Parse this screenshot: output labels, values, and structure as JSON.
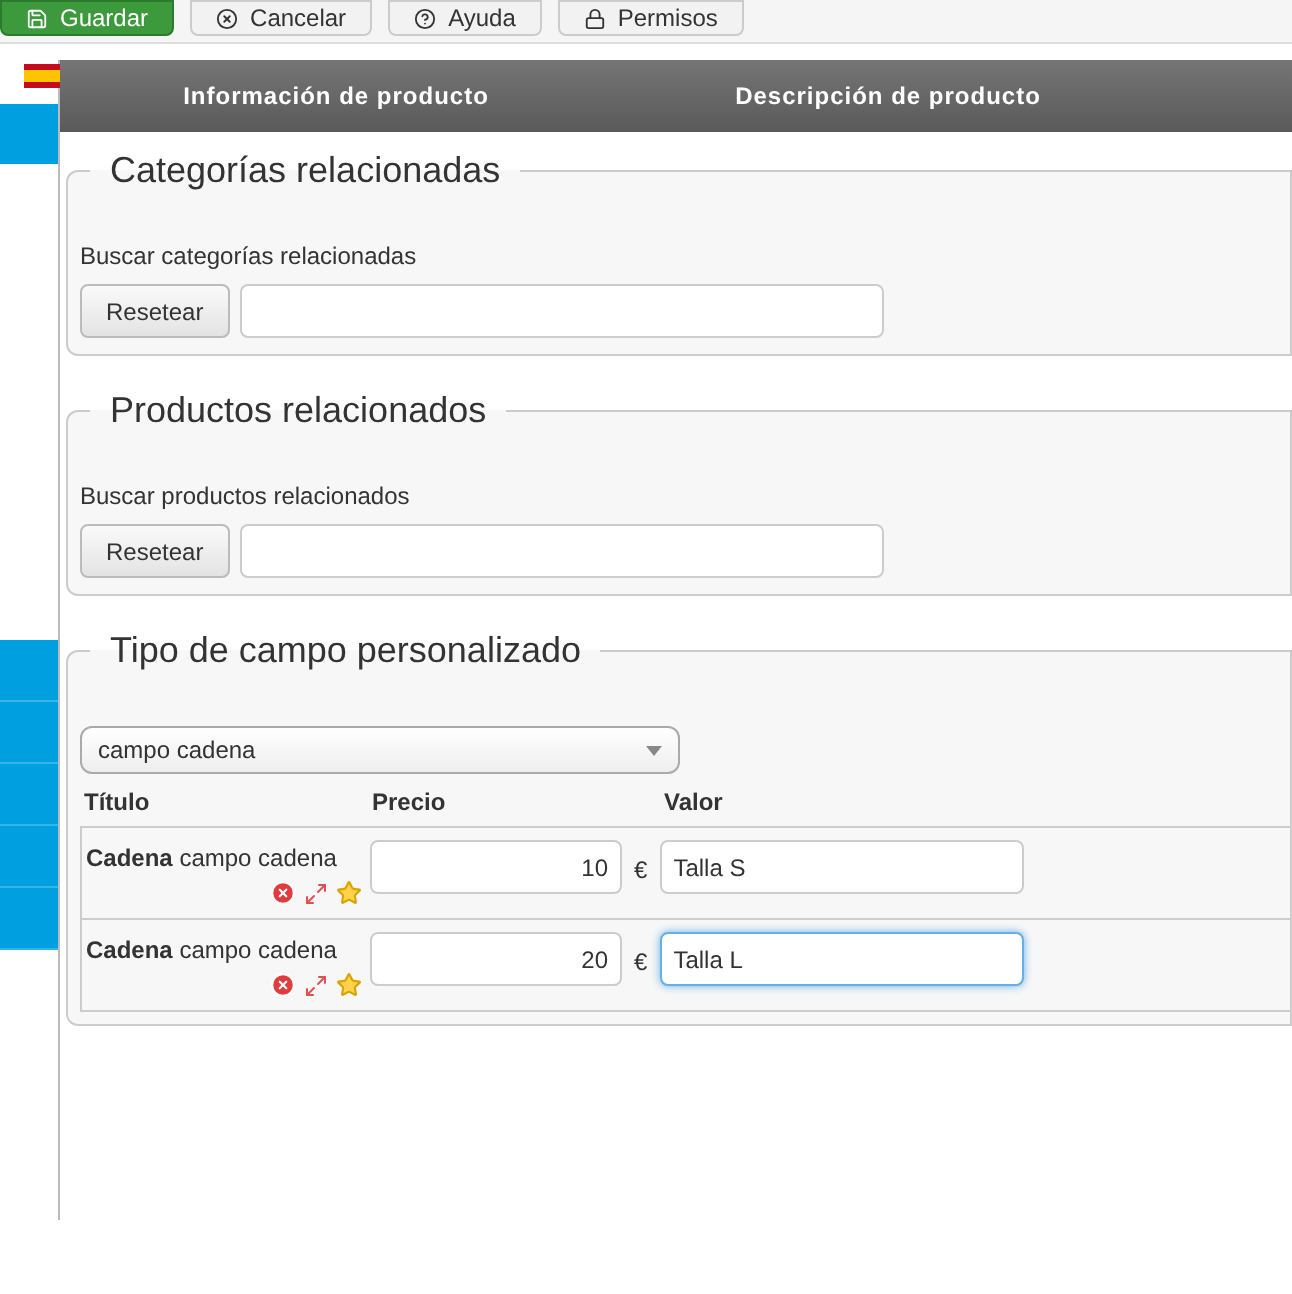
{
  "toolbar": [
    {
      "label": "Guardar",
      "kind": "primary"
    },
    {
      "label": "Cancelar",
      "kind": "default"
    },
    {
      "label": "Ayuda",
      "kind": "default"
    },
    {
      "label": "Permisos",
      "kind": "default"
    }
  ],
  "tabs": [
    {
      "label": "Información de producto"
    },
    {
      "label": "Descripción de producto"
    }
  ],
  "related_categories": {
    "legend": "Categorías relacionadas",
    "label": "Buscar categorías relacionadas",
    "button": "Resetear"
  },
  "related_products": {
    "legend": "Productos relacionados",
    "label": "Buscar productos relacionados",
    "button": "Resetear"
  },
  "custom_field": {
    "legend": "Tipo de campo personalizado",
    "select_value": "campo cadena",
    "columns": [
      "Título",
      "Precio",
      "Valor"
    ],
    "rows": [
      {
        "title": "**Cadena** campo cadena",
        "price": "10",
        "currency": "€",
        "value": "Talla S",
        "focused": false
      },
      {
        "title": "**Cadena** campo cadena",
        "price": "20",
        "currency": "€",
        "value": "Talla L",
        "focused": true
      }
    ]
  }
}
